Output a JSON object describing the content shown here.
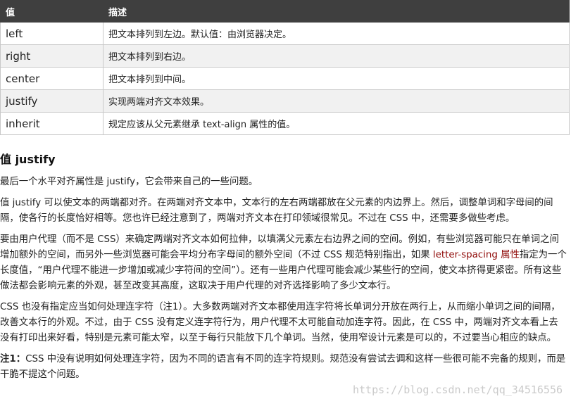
{
  "table": {
    "headers": [
      "值",
      "描述"
    ],
    "rows": [
      {
        "value": "left",
        "description": "把文本排列到左边。默认值：由浏览器决定。"
      },
      {
        "value": "right",
        "description": "把文本排列到右边。"
      },
      {
        "value": "center",
        "description": "把文本排列到中间。"
      },
      {
        "value": "justify",
        "description": "实现两端对齐文本效果。"
      },
      {
        "value": "inherit",
        "description": "规定应该从父元素继承 text-align 属性的值。"
      }
    ]
  },
  "section": {
    "heading": "值 justify",
    "p1": "最后一个水平对齐属性是 justify，它会带来自己的一些问题。",
    "p2": "值 justify 可以使文本的两端都对齐。在两端对齐文本中，文本行的左右两端都放在父元素的内边界上。然后，调整单词和字母间的间隔，使各行的长度恰好相等。您也许已经注意到了，两端对齐文本在打印领域很常见。不过在 CSS 中，还需要多做些考虑。",
    "p3_before": "要由用户代理（而不是 CSS）来确定两端对齐文本如何拉伸，以填满父元素左右边界之间的空间。例如，有些浏览器可能只在单词之间增加额外的空间，而另外一些浏览器可能会平均分布字母间的额外空间（不过 CSS 规范特别指出，如果 ",
    "p3_link": "letter-spacing 属性",
    "p3_after": "指定为一个长度值，“用户代理不能进一步增加或减少字符间的空间”）。还有一些用户代理可能会减少某些行的空间，使文本挤得更紧密。所有这些做法都会影响元素的外观，甚至改变其高度，这取决于用户代理的对齐选择影响了多少文本行。",
    "p4": "CSS 也没有指定应当如何处理连字符（注1）。大多数两端对齐文本都使用连字符将长单词分开放在两行上，从而缩小单词之间的间隔，改善文本行的外观。不过，由于 CSS 没有定义连字符行为，用户代理不太可能自动加连字符。因此，在 CSS 中，两端对齐文本看上去没有打印出来好看，特别是元素可能太窄，以至于每行只能放下几个单词。当然，使用窄设计元素是可以的，不过要当心相应的缺点。",
    "note_label": "注1：",
    "note_text": "CSS 中没有说明如何处理连字符，因为不同的语言有不同的连字符规则。规范没有尝试去调和这样一些很可能不完备的规则，而是干脆不提这个问题。"
  },
  "watermark": "https://blog.csdn.net/qq_34516556"
}
